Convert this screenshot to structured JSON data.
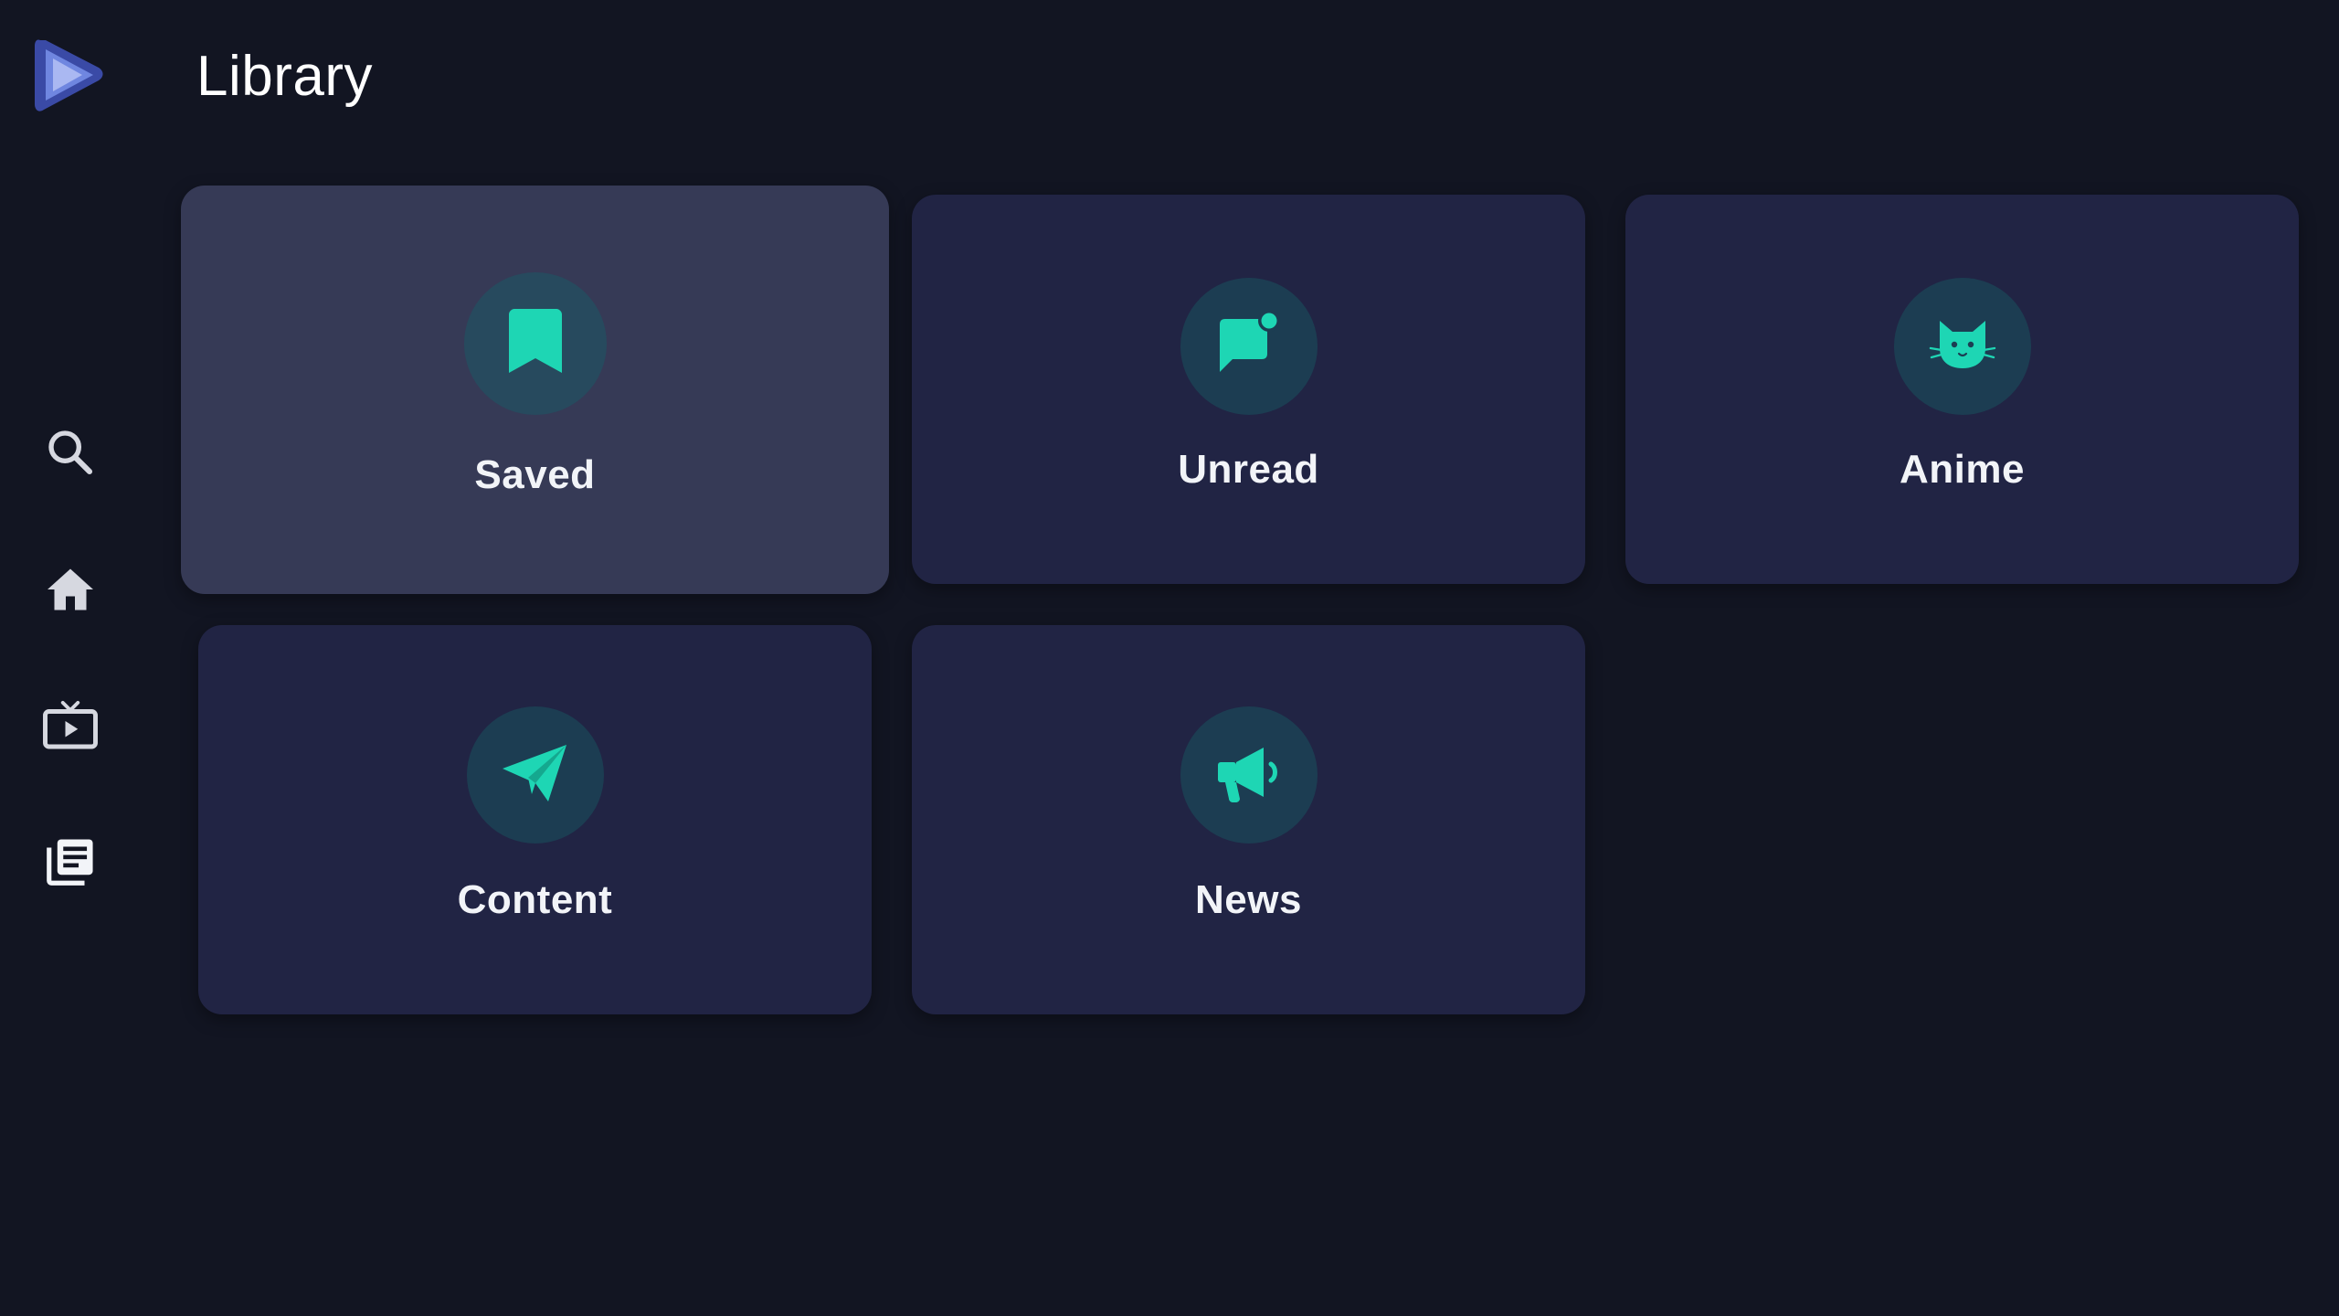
{
  "header": {
    "title": "Library"
  },
  "sidebar": {
    "logo": "play-logo",
    "items": [
      {
        "name": "search",
        "icon": "search-icon"
      },
      {
        "name": "home",
        "icon": "home-icon"
      },
      {
        "name": "tv",
        "icon": "tv-icon"
      },
      {
        "name": "library",
        "icon": "library-icon",
        "active": true
      }
    ]
  },
  "library": {
    "cards": [
      {
        "label": "Saved",
        "icon": "bookmark-icon",
        "focused": true
      },
      {
        "label": "Unread",
        "icon": "chat-notification-icon"
      },
      {
        "label": "Anime",
        "icon": "cat-icon"
      },
      {
        "label": "Content",
        "icon": "paper-plane-icon"
      },
      {
        "label": "News",
        "icon": "megaphone-icon"
      }
    ]
  },
  "colors": {
    "background": "#121522",
    "card": "#212444",
    "card_focused": "#363a56",
    "accent": "#1ed6b4",
    "icon_circle": "#1c3d52",
    "logo": "#5a6ec8"
  }
}
